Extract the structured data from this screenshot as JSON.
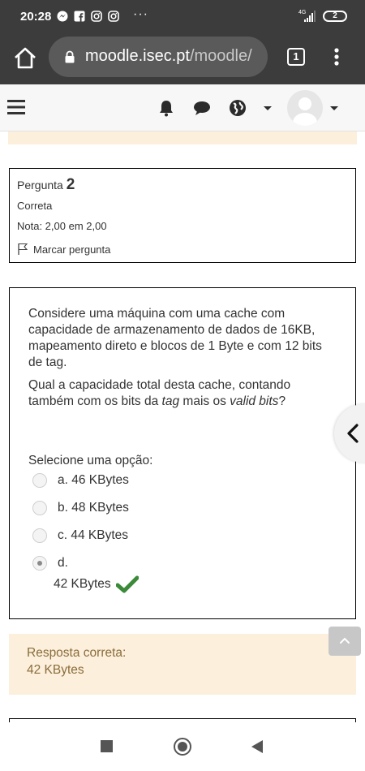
{
  "status_bar": {
    "time": "20:28",
    "network": "4G",
    "battery": "2",
    "more": "···"
  },
  "browser": {
    "url_host": "moodle.isec.pt",
    "url_path": "/moodle/",
    "tab_count": "1"
  },
  "icons": {
    "home": "home-icon",
    "lock": "lock-icon",
    "menu": "more-vert-icon",
    "hamburger": "menu-icon",
    "notifications": "bell-icon",
    "messages": "chat-icon",
    "language": "globe-icon",
    "user": "avatar-icon"
  },
  "question_info": {
    "label": "Pergunta",
    "number": "2",
    "state": "Correta",
    "grade": "Nota: 2,00 em 2,00",
    "flag": "Marcar pergunta"
  },
  "question": {
    "text1": "Considere uma máquina com uma cache com capacidade de armazenamento de dados de 16KB, mapeamento direto e blocos de 1 Byte e com 12 bits de tag.",
    "text2_a": "Qual a capacidade total desta cache, contando também com os bits da ",
    "text2_tag": "tag",
    "text2_b": " mais os ",
    "text2_valid": "valid bits",
    "text2_c": "?",
    "prompt": "Selecione uma opção:",
    "options": [
      {
        "letter": "a.",
        "text": "46 KBytes",
        "selected": false
      },
      {
        "letter": "b.",
        "text": "48 KBytes",
        "selected": false
      },
      {
        "letter": "c.",
        "text": "44 KBytes",
        "selected": false
      },
      {
        "letter": "d.",
        "text": "42 KBytes",
        "selected": true
      }
    ]
  },
  "feedback": {
    "label": "Resposta correta:",
    "value": "42 KBytes"
  },
  "colors": {
    "correct": "#3a8a3a",
    "feedback_bg": "#fcefdc",
    "feedback_text": "#8a6d3b"
  }
}
